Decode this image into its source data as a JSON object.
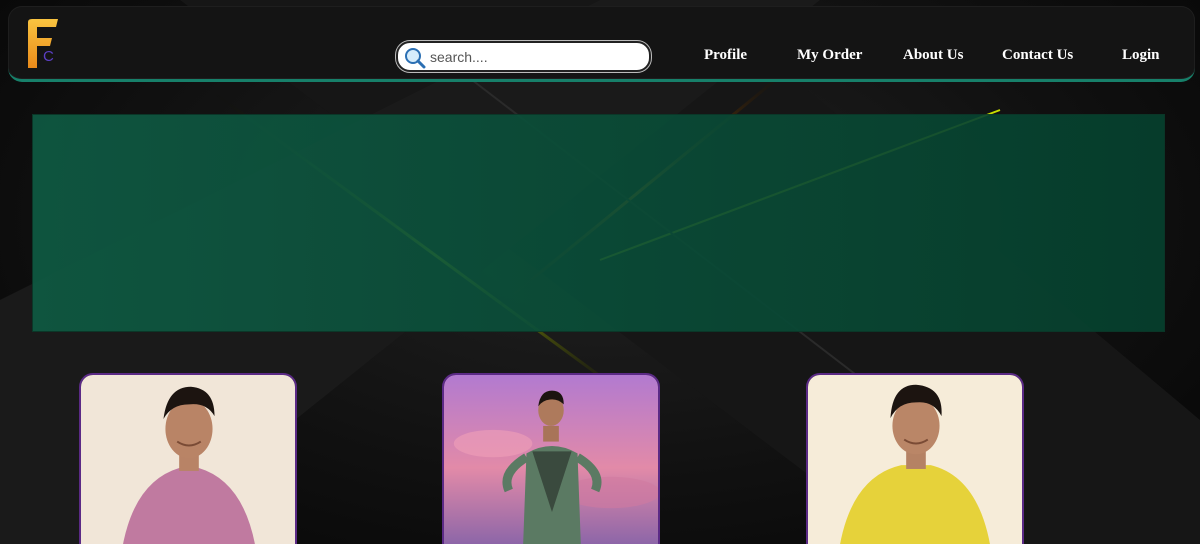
{
  "brand": {
    "logo_letters": "FC",
    "logo_colors": [
      "#f7b733",
      "#5b3fc4"
    ]
  },
  "search": {
    "placeholder": "search....",
    "value": "",
    "icon": "search-icon"
  },
  "nav": {
    "profile": "Profile",
    "my_order": "My Order",
    "about_us": "About Us",
    "contact_us": "Contact Us",
    "login": "Login"
  },
  "colors": {
    "navbar_bg": "#141414",
    "navbar_border": "#17806a",
    "banner": "#0b5440",
    "card_border": "#5b2a86"
  },
  "products": [
    {
      "shirt_color": "#c07aa0",
      "background": "cream"
    },
    {
      "shirt_color": "#5b7a63",
      "background": "pink-sky"
    },
    {
      "shirt_color": "#e6d23a",
      "background": "cream"
    }
  ]
}
